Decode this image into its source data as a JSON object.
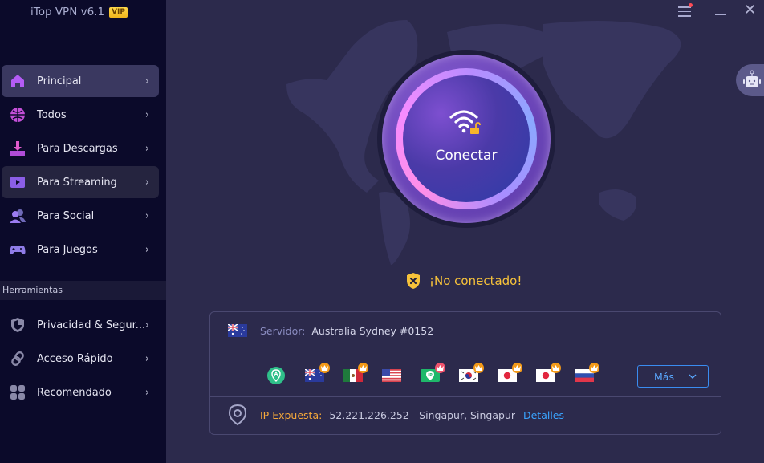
{
  "app": {
    "title": "iTop VPN v6.1",
    "badge": "VIP"
  },
  "sidebar": {
    "items": [
      {
        "label": "Principal",
        "icon": "home-icon",
        "state": "active"
      },
      {
        "label": "Todos",
        "icon": "globe-icon"
      },
      {
        "label": "Para Descargas",
        "icon": "download-icon"
      },
      {
        "label": "Para Streaming",
        "icon": "play-icon",
        "state": "hover"
      },
      {
        "label": "Para Social",
        "icon": "users-icon"
      },
      {
        "label": "Para Juegos",
        "icon": "gamepad-icon"
      }
    ],
    "section_label": "Herramientas",
    "tools": [
      {
        "label": "Privacidad & Segur...",
        "icon": "shield-icon"
      },
      {
        "label": "Acceso Rápido",
        "icon": "link-icon"
      },
      {
        "label": "Recomendado",
        "icon": "grid-icon"
      }
    ],
    "chevron": "›"
  },
  "window": {
    "close_glyph": "✕"
  },
  "connect": {
    "label": "Conectar"
  },
  "status": {
    "text": "¡No conectado!",
    "color": "#f7c23a"
  },
  "server": {
    "label": "Servidor:",
    "value": "Australia Sydney #0152",
    "flag": "australia"
  },
  "quick_servers": [
    {
      "name": "smart-location",
      "premium": false
    },
    {
      "name": "australia",
      "premium": true
    },
    {
      "name": "mexico",
      "premium": true
    },
    {
      "name": "united-states",
      "premium": false
    },
    {
      "name": "dedicated-ip",
      "premium": true
    },
    {
      "name": "south-korea",
      "premium": true
    },
    {
      "name": "japan",
      "premium": true
    },
    {
      "name": "japan",
      "premium": true
    },
    {
      "name": "russia",
      "premium": true
    }
  ],
  "more_button": {
    "label": "Más"
  },
  "ip": {
    "label": "IP Expuesta:",
    "value": "52.221.226.252 - Singapur, Singapur",
    "link": "Detalles"
  }
}
